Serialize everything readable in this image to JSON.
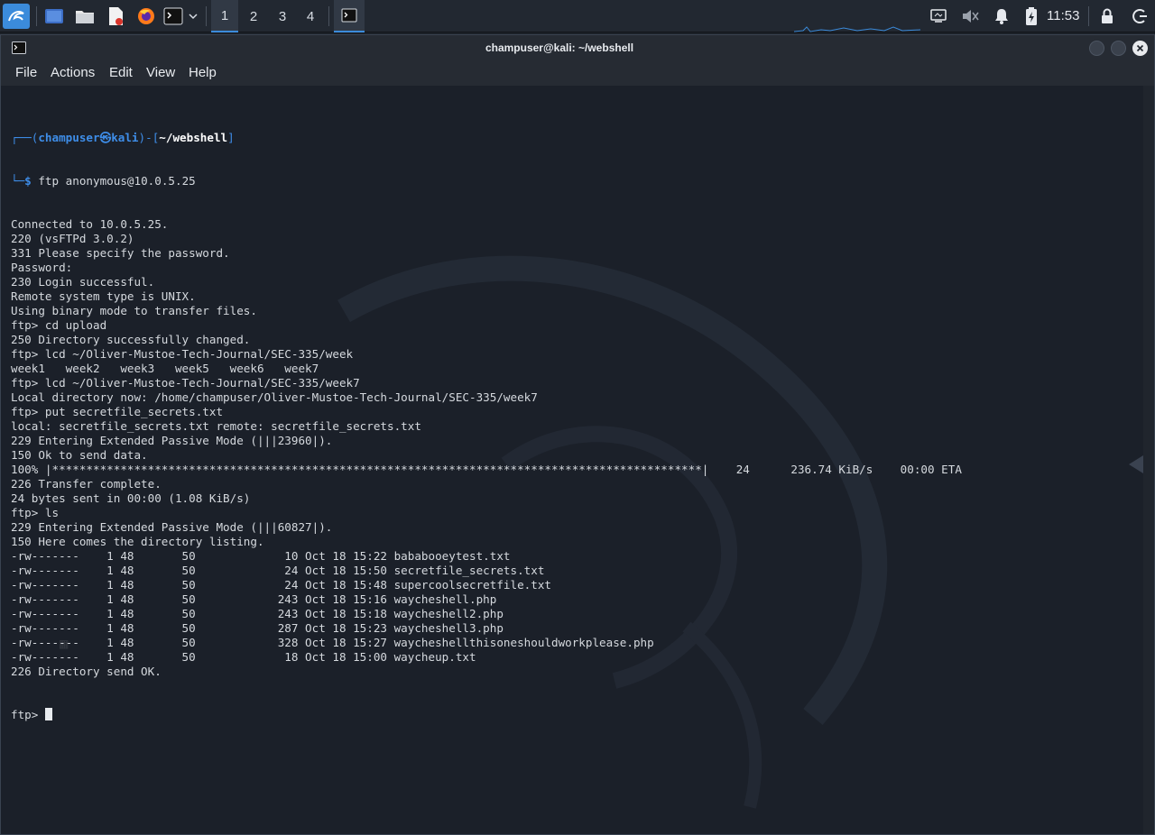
{
  "taskbar": {
    "workspaces": [
      "1",
      "2",
      "3",
      "4"
    ],
    "active_workspace": "1",
    "clock": "11:53"
  },
  "window": {
    "title": "champuser@kali: ~/webshell"
  },
  "menu": [
    "File",
    "Actions",
    "Edit",
    "View",
    "Help"
  ],
  "prompt": {
    "user": "champuser",
    "host": "kali",
    "path": "~/webshell",
    "command": "ftp anonymous@10.0.5.25"
  },
  "terminal_lines": [
    "Connected to 10.0.5.25.",
    "220 (vsFTPd 3.0.2)",
    "331 Please specify the password.",
    "Password:",
    "230 Login successful.",
    "Remote system type is UNIX.",
    "Using binary mode to transfer files.",
    "ftp> cd upload",
    "250 Directory successfully changed.",
    "ftp> lcd ~/Oliver-Mustoe-Tech-Journal/SEC-335/week",
    "week1   week2   week3   week5   week6   week7",
    "ftp> lcd ~/Oliver-Mustoe-Tech-Journal/SEC-335/week7",
    "Local directory now: /home/champuser/Oliver-Mustoe-Tech-Journal/SEC-335/week7",
    "ftp> put secretfile_secrets.txt",
    "local: secretfile_secrets.txt remote: secretfile_secrets.txt",
    "229 Entering Extended Passive Mode (|||23960|).",
    "150 Ok to send data.",
    "100% |***********************************************************************************************|    24      236.74 KiB/s    00:00 ETA",
    "226 Transfer complete.",
    "24 bytes sent in 00:00 (1.08 KiB/s)",
    "ftp> ls",
    "229 Entering Extended Passive Mode (|||60827|).",
    "150 Here comes the directory listing.",
    "-rw-------    1 48       50             10 Oct 18 15:22 bababooeytest.txt",
    "-rw-------    1 48       50             24 Oct 18 15:50 secretfile_secrets.txt",
    "-rw-------    1 48       50             24 Oct 18 15:48 supercoolsecretfile.txt",
    "-rw-------    1 48       50            243 Oct 18 15:16 waycheshell.php",
    "-rw-------    1 48       50            243 Oct 18 15:18 waycheshell2.php",
    "-rw-------    1 48       50            287 Oct 18 15:23 waycheshell3.php",
    "-rw-------    1 48       50            328 Oct 18 15:27 waycheshellthisoneshouldworkplease.php",
    "-rw-------    1 48       50             18 Oct 18 15:00 waycheup.txt",
    "226 Directory send OK."
  ],
  "current_prompt": "ftp> "
}
